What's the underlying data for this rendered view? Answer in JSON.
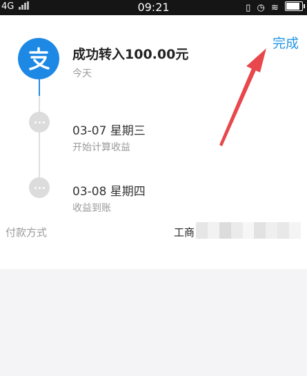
{
  "status_bar": {
    "network": "4G",
    "time": "09:21"
  },
  "header": {
    "done_label": "完成"
  },
  "timeline": {
    "main": {
      "title": "成功转入100.00元",
      "subtitle": "今天"
    },
    "steps": [
      {
        "title": "03-07 星期三",
        "subtitle": "开始计算收益"
      },
      {
        "title": "03-08 星期四",
        "subtitle": "收益到账"
      }
    ]
  },
  "payment": {
    "label": "付款方式",
    "value": "工商"
  },
  "colors": {
    "accent": "#2196e6",
    "logo": "#1e88e5",
    "arrow": "#e8474c"
  }
}
